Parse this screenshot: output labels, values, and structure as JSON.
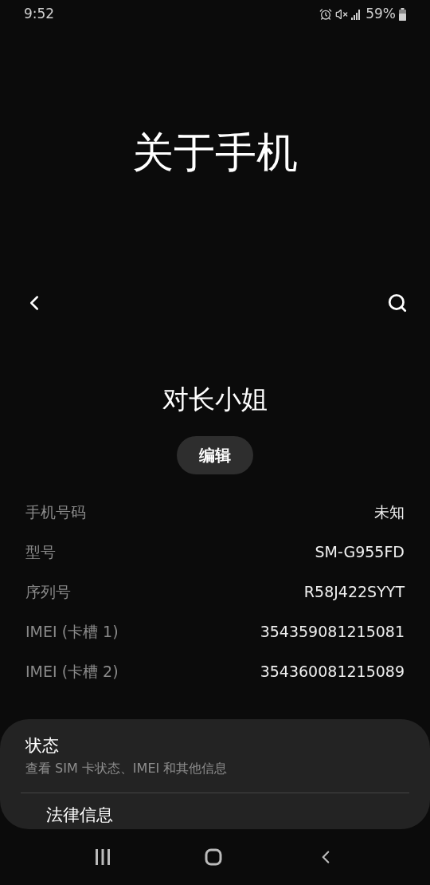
{
  "status_bar": {
    "time": "9:52",
    "battery": "59%"
  },
  "title": "关于手机",
  "device_name": "对长小姐",
  "edit_button": "编辑",
  "info_rows": [
    {
      "label": "手机号码",
      "value": "未知"
    },
    {
      "label": "型号",
      "value": "SM-G955FD"
    },
    {
      "label": "序列号",
      "value": "R58J422SYYT"
    },
    {
      "label": "IMEI (卡槽 1)",
      "value": "354359081215081"
    },
    {
      "label": "IMEI (卡槽 2)",
      "value": "354360081215089"
    }
  ],
  "menu_items": [
    {
      "title": "状态",
      "subtitle": "查看 SIM 卡状态、IMEI 和其他信息"
    },
    {
      "title": "法律信息"
    }
  ]
}
